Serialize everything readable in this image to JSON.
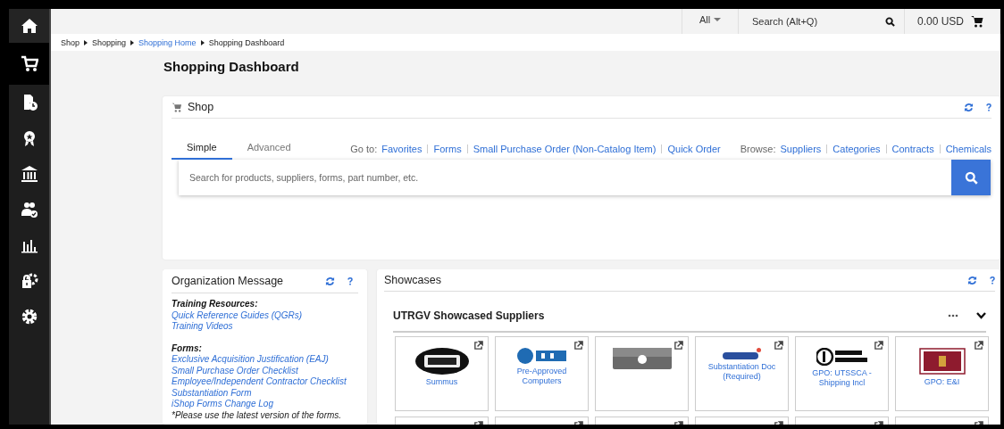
{
  "sidebar": {
    "items": [
      {
        "selected": false
      },
      {
        "selected": true
      },
      {
        "selected": false
      },
      {
        "selected": false
      },
      {
        "selected": false
      },
      {
        "selected": false
      },
      {
        "selected": false
      },
      {
        "selected": false
      },
      {
        "selected": false
      }
    ]
  },
  "top_bar": {
    "scope": "All",
    "search_placeholder": "Search (Alt+Q)",
    "cart_total": "0.00 USD"
  },
  "breadcrumb": [
    {
      "label": "Shop",
      "link": false
    },
    {
      "label": "Shopping",
      "link": false
    },
    {
      "label": "Shopping Home",
      "link": true
    },
    {
      "label": "Shopping Dashboard",
      "link": false
    }
  ],
  "page_title": "Shopping Dashboard",
  "shop": {
    "title": "Shop",
    "tabs": [
      {
        "label": "Simple",
        "selected": true
      },
      {
        "label": "Advanced",
        "selected": false
      }
    ],
    "goto_label": "Go to:",
    "goto_links": [
      "Favorites",
      "Forms",
      "Small Purchase Order (Non-Catalog Item)",
      "Quick Order"
    ],
    "browse_label": "Browse:",
    "browse_links": [
      "Suppliers",
      "Categories",
      "Contracts",
      "Chemicals"
    ],
    "search_placeholder": "Search for products, suppliers, forms, part number, etc."
  },
  "org_message": {
    "title": "Organization Message",
    "lines": [
      {
        "kind": "heading",
        "text": "Training Resources:"
      },
      {
        "kind": "link",
        "text": "Quick Reference Guides (QGRs)"
      },
      {
        "kind": "link",
        "text": "Training Videos"
      },
      {
        "kind": "spacer"
      },
      {
        "kind": "heading",
        "text": "Forms:"
      },
      {
        "kind": "link",
        "text": "Exclusive Acquisition Justification (EAJ)"
      },
      {
        "kind": "link",
        "text": "Small Purchase Order Checklist"
      },
      {
        "kind": "link",
        "text": "Employee/Independent Contractor Checklist"
      },
      {
        "kind": "link",
        "text": "Substantiation Form"
      },
      {
        "kind": "link",
        "text": "iShop Forms Change Log"
      },
      {
        "kind": "note",
        "text": "*Please use the latest version of the forms."
      }
    ]
  },
  "showcases": {
    "title": "Showcases",
    "section_title": "UTRGV Showcased Suppliers",
    "tiles": [
      {
        "kind": "picture",
        "label": "Summus"
      },
      {
        "kind": "picture",
        "label": "Pre-Approved Computers"
      },
      {
        "kind": "picture"
      },
      {
        "kind": "picture",
        "label": "Substantiation Doc (Required)"
      },
      {
        "kind": "picture",
        "label": "GPO: UTSSCA - Shipping Incl"
      },
      {
        "kind": "picture",
        "label": "GPO: E&I"
      },
      {
        "kind": "blank"
      },
      {
        "kind": "blank"
      },
      {
        "kind": "blank"
      },
      {
        "kind": "blank"
      },
      {
        "kind": "blank"
      },
      {
        "kind": "blank"
      }
    ]
  }
}
